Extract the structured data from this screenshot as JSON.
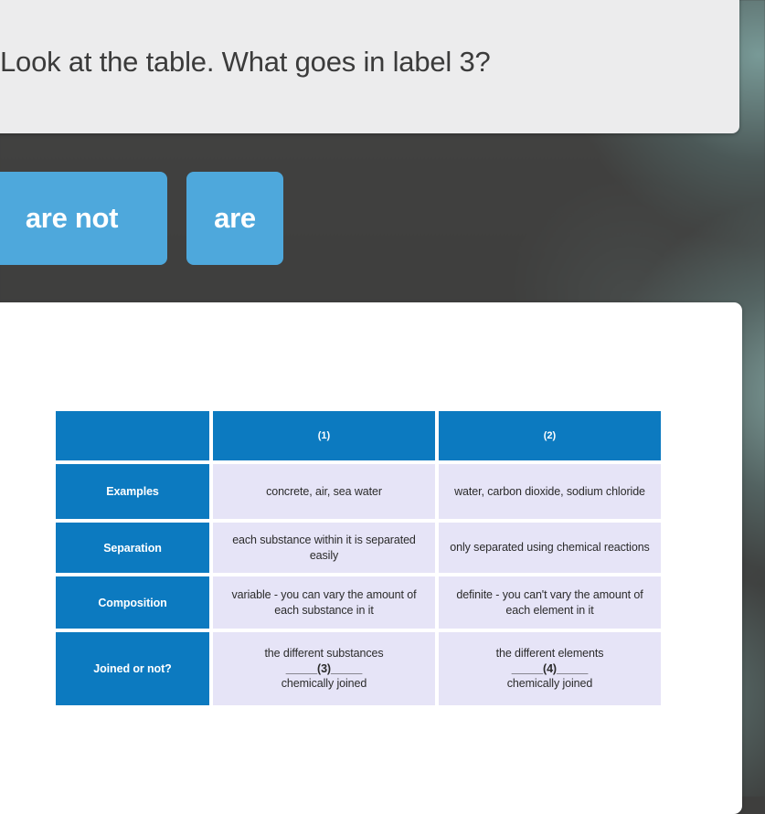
{
  "question": {
    "prompt": "Look at the table. What goes in label 3?"
  },
  "answers": {
    "options": [
      {
        "label": "are not"
      },
      {
        "label": "are"
      }
    ]
  },
  "figure": {
    "type": "table",
    "header": {
      "corner": "",
      "columns": [
        "(1)",
        "(2)"
      ]
    },
    "rows": [
      {
        "label": "Examples",
        "cells": [
          "concrete, air, sea water",
          "water, carbon dioxide, sodium chloride"
        ]
      },
      {
        "label": "Separation",
        "cells": [
          "each substance within it is separated easily",
          "only separated using chemical reactions"
        ]
      },
      {
        "label": "Composition",
        "cells": [
          "variable - you can vary the amount of each substance in it",
          "definite - you can't vary the amount of each element in it"
        ]
      },
      {
        "label": "Joined or not?",
        "cells_multiline": [
          {
            "line1": "the different substances",
            "line2": "_____(3)_____",
            "line3": "chemically joined"
          },
          {
            "line1": "the different elements",
            "line2": "_____(4)_____",
            "line3": "chemically joined"
          }
        ]
      }
    ]
  },
  "colors": {
    "panel_background": "#ececed",
    "button_blue": "#4ea8dc",
    "table_header_blue": "#0c7ac0",
    "table_cell_lavender": "#e6e4f7",
    "page_background": "#3e3e3d",
    "card_white": "#ffffff"
  }
}
